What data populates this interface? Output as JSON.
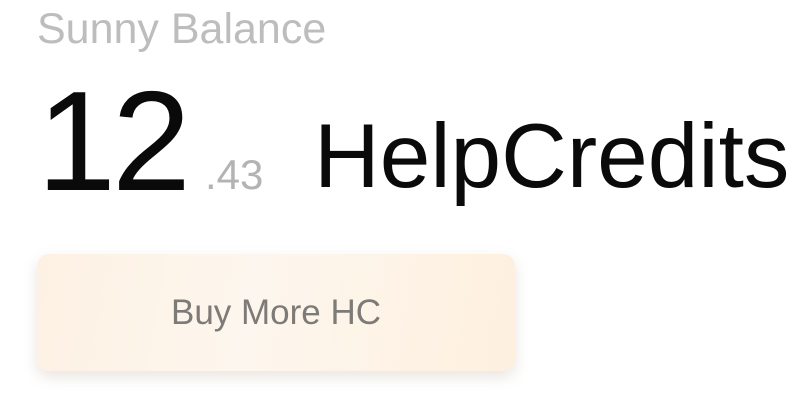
{
  "balance": {
    "label": "Sunny Balance",
    "integer": "12",
    "decimal": ".43",
    "unit": "HelpCredits"
  },
  "actions": {
    "buy_label": "Buy More HC"
  },
  "colors": {
    "label": "#bdbdbd",
    "amount": "#0a0a0a",
    "decimal": "#b3b3b3",
    "button_bg": "#fdf3e8",
    "button_text": "#7d7a77"
  }
}
